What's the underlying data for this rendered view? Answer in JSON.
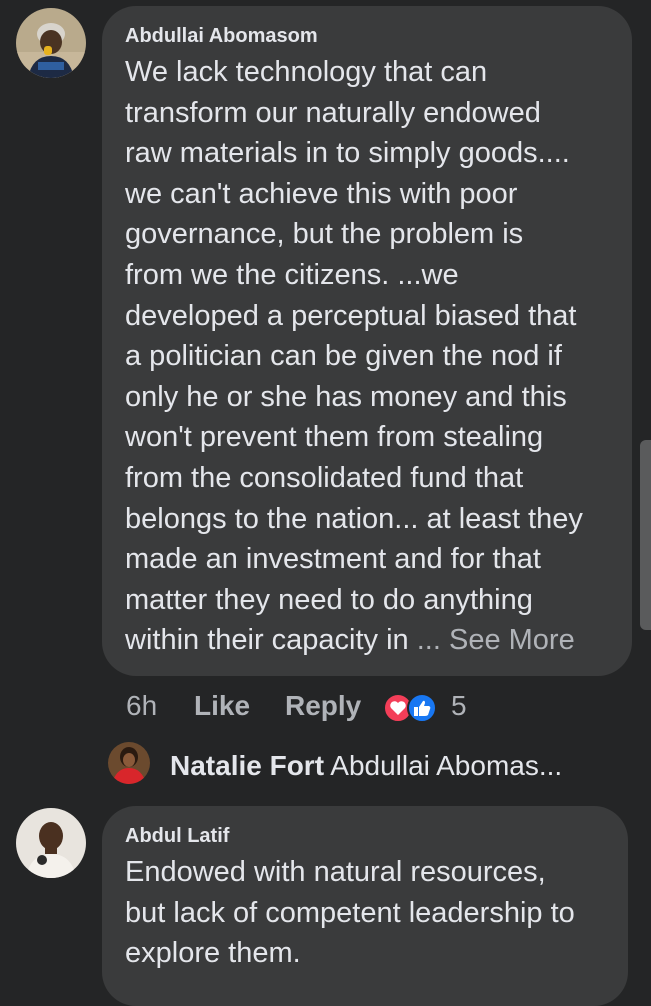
{
  "comments": [
    {
      "author": "Abdullai Abomasom",
      "lines": [
        "We lack technology that can",
        "transform our naturally endowed",
        "raw materials in to simply goods....",
        "we can't achieve this with poor",
        "governance,  but the problem is",
        "from we the citizens. ...we",
        "developed a perceptual biased that",
        "a politician can be given  the nod if",
        "only he or she has money and this",
        "won't prevent them from stealing",
        "from the consolidated fund that",
        "belongs to the nation... at least they",
        "made an investment and for that",
        "matter they need to do anything"
      ],
      "last_line": "within their capacity in ",
      "see_more": "... See More",
      "time": "6h",
      "like_label": "Like",
      "reply_label": "Reply",
      "reaction_count": "5",
      "reaction_icons": [
        "love-icon",
        "like-icon"
      ]
    },
    {
      "author": "Abdul Latif",
      "lines": [
        "Endowed with natural resources,",
        "but lack of competent leadership to",
        "explore them."
      ]
    }
  ],
  "reply_preview": {
    "author": "Natalie Fort",
    "text": "Abdullai Abomas..."
  },
  "colors": {
    "background": "#242526",
    "bubble": "#3a3b3c",
    "text": "#e4e6eb",
    "secondary_text": "#b0b3b8",
    "love": "#f33e58",
    "like": "#1877f2"
  }
}
